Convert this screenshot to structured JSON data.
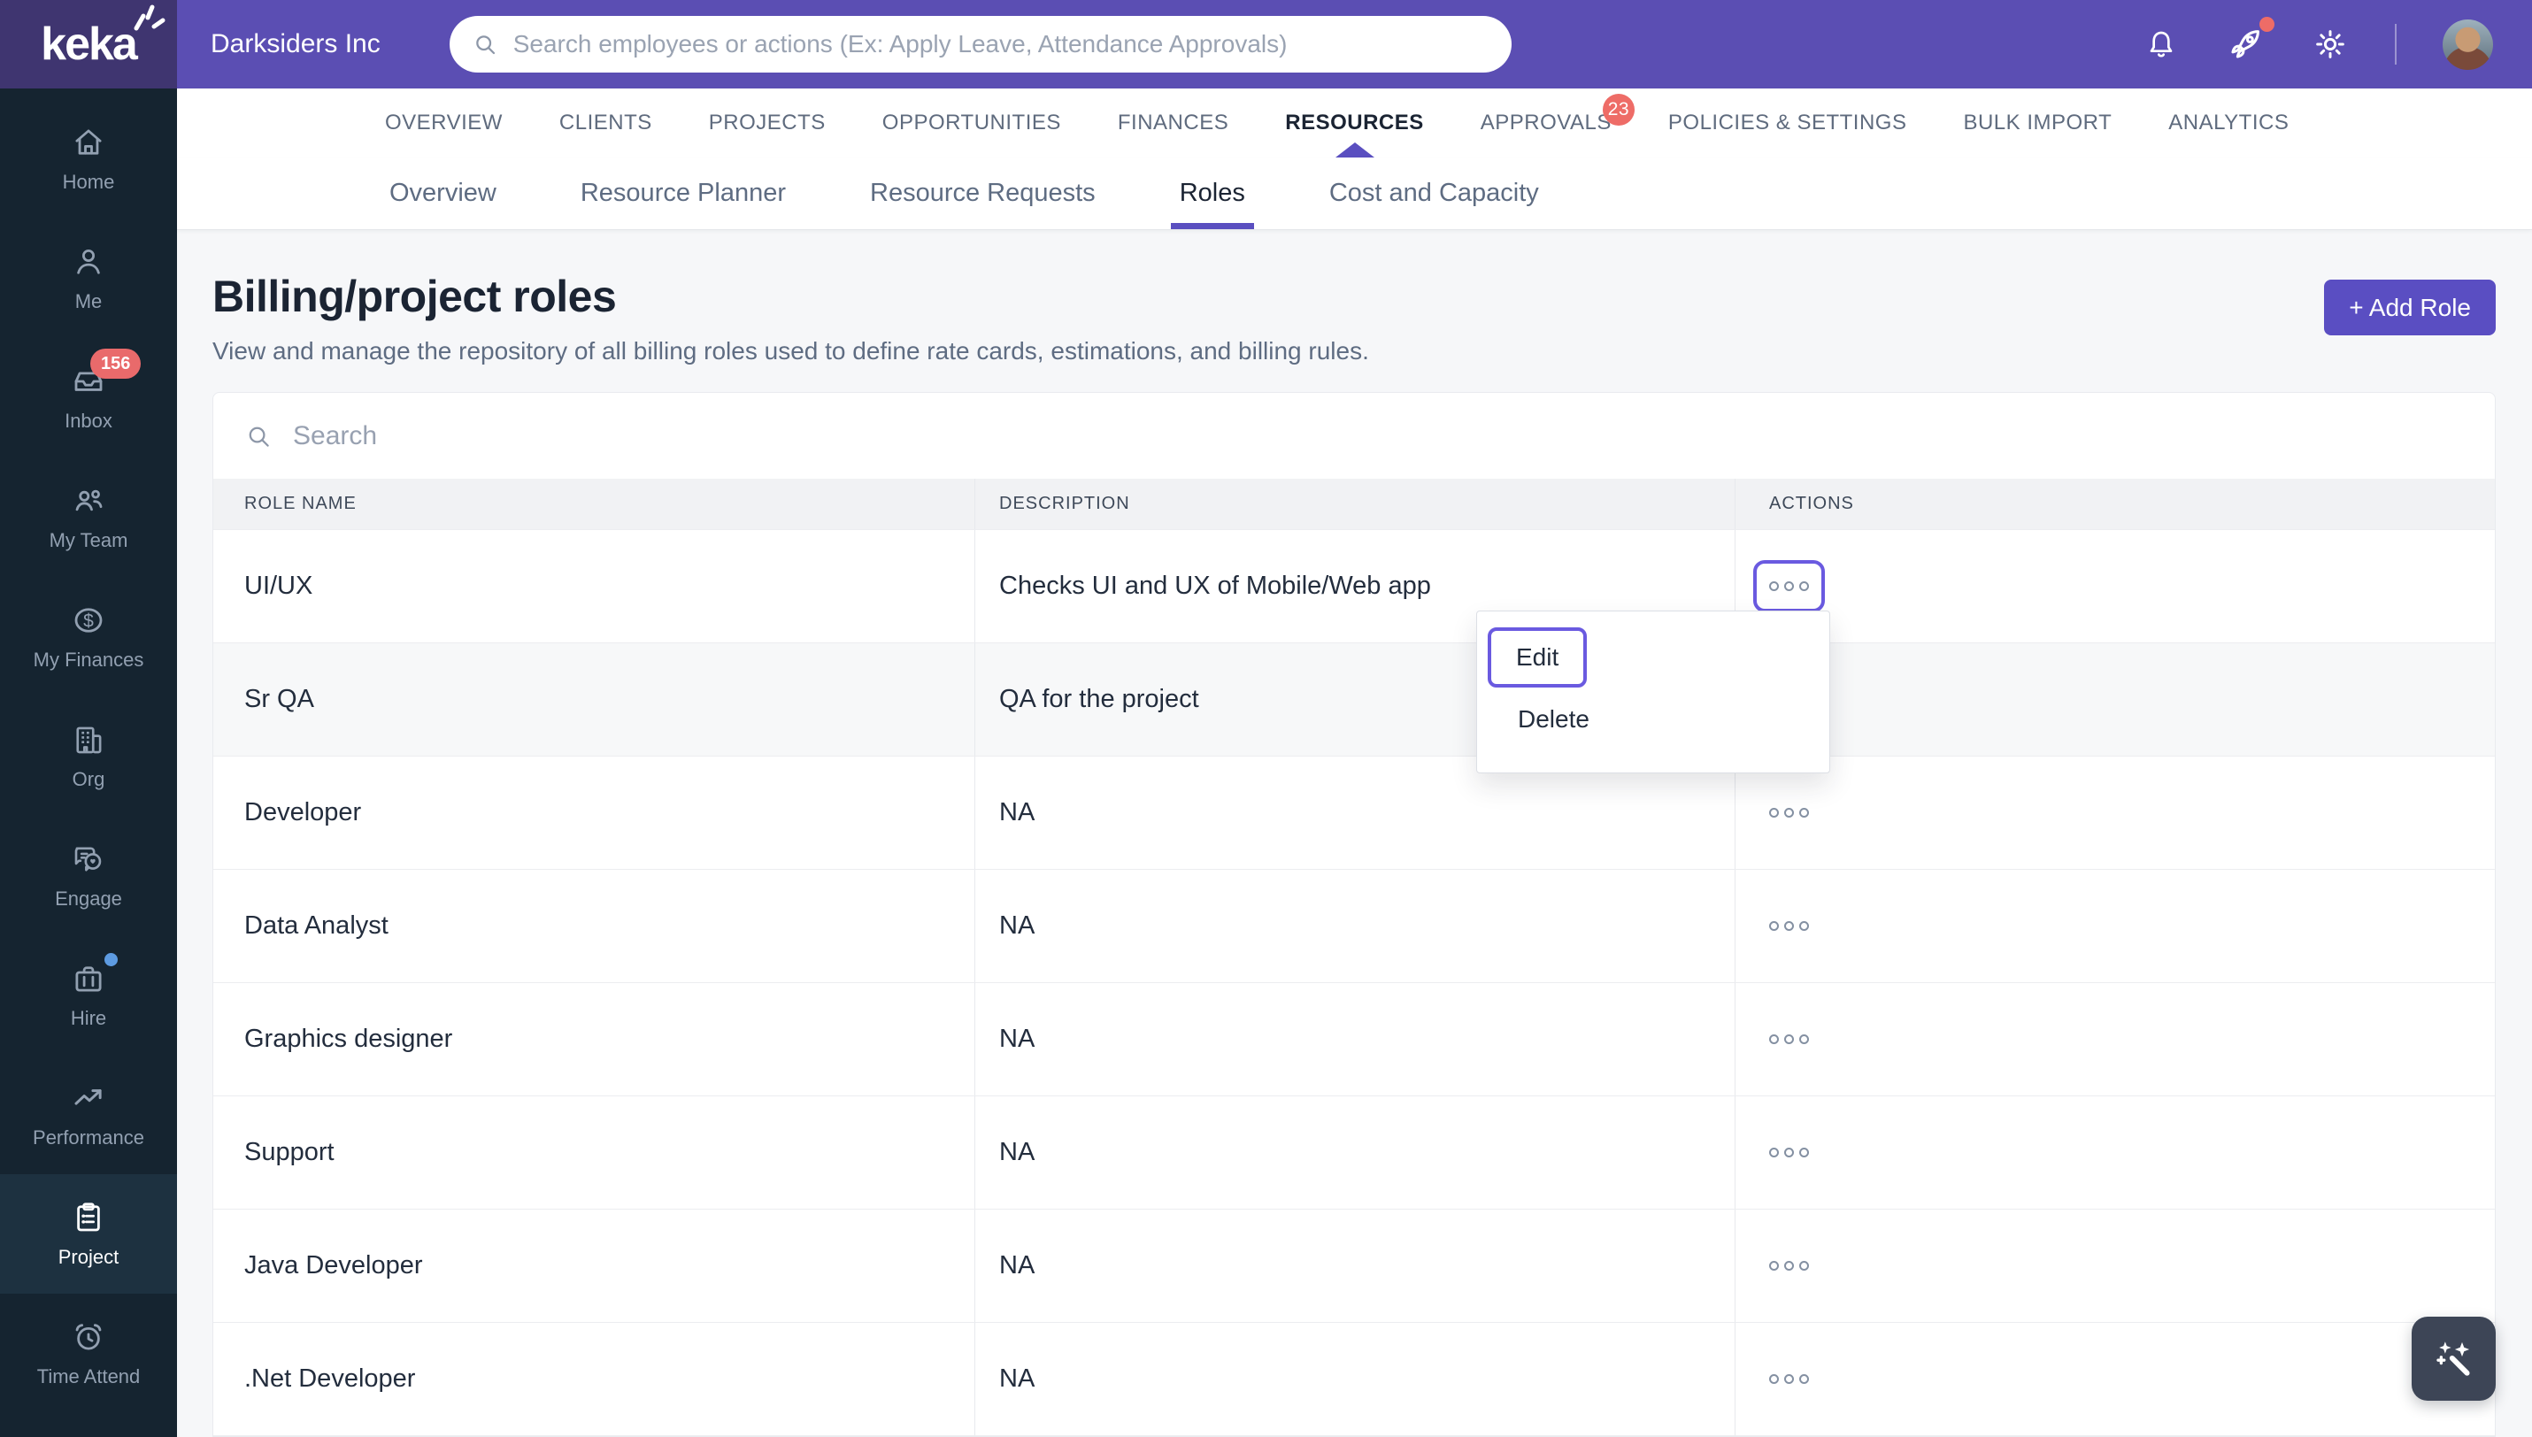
{
  "topbar": {
    "logo_text": "keka",
    "company_name": "Darksiders Inc",
    "search_placeholder": "Search employees or actions (Ex: Apply Leave, Attendance Approvals)",
    "icons": [
      "bell-icon",
      "rocket-icon",
      "gear-icon",
      "avatar"
    ]
  },
  "main_nav": {
    "items": [
      {
        "label": "OVERVIEW",
        "active": false
      },
      {
        "label": "CLIENTS",
        "active": false
      },
      {
        "label": "PROJECTS",
        "active": false
      },
      {
        "label": "OPPORTUNITIES",
        "active": false
      },
      {
        "label": "FINANCES",
        "active": false
      },
      {
        "label": "RESOURCES",
        "active": true
      },
      {
        "label": "APPROVALS",
        "active": false,
        "badge": "23"
      },
      {
        "label": "POLICIES & SETTINGS",
        "active": false
      },
      {
        "label": "BULK IMPORT",
        "active": false
      },
      {
        "label": "ANALYTICS",
        "active": false
      }
    ]
  },
  "sub_nav": {
    "items": [
      {
        "label": "Overview",
        "active": false
      },
      {
        "label": "Resource Planner",
        "active": false
      },
      {
        "label": "Resource Requests",
        "active": false
      },
      {
        "label": "Roles",
        "active": true
      },
      {
        "label": "Cost and Capacity",
        "active": false
      }
    ]
  },
  "sidebar": {
    "items": [
      {
        "label": "Home",
        "icon": "home-icon"
      },
      {
        "label": "Me",
        "icon": "user-icon"
      },
      {
        "label": "Inbox",
        "icon": "inbox-icon",
        "badge": "156"
      },
      {
        "label": "My Team",
        "icon": "team-icon"
      },
      {
        "label": "My Finances",
        "icon": "dollar-icon"
      },
      {
        "label": "Org",
        "icon": "building-icon"
      },
      {
        "label": "Engage",
        "icon": "chat-icon"
      },
      {
        "label": "Hire",
        "icon": "briefcase-icon",
        "notification_dot": true
      },
      {
        "label": "Performance",
        "icon": "trend-icon"
      },
      {
        "label": "Project",
        "icon": "clipboard-icon",
        "active": true
      },
      {
        "label": "Time Attend",
        "icon": "alarm-icon"
      }
    ]
  },
  "page": {
    "title": "Billing/project roles",
    "subtitle": "View and manage the repository of all billing roles used to define rate cards, estimations, and billing rules.",
    "add_role_label": "+ Add Role"
  },
  "table": {
    "search_placeholder": "Search",
    "columns": [
      "ROLE NAME",
      "DESCRIPTION",
      "ACTIONS"
    ],
    "rows": [
      {
        "role": "UI/UX",
        "description": "Checks UI and UX of Mobile/Web app"
      },
      {
        "role": "Sr QA",
        "description": "QA for the project"
      },
      {
        "role": "Developer",
        "description": "NA"
      },
      {
        "role": "Data Analyst",
        "description": "NA"
      },
      {
        "role": "Graphics designer",
        "description": "NA"
      },
      {
        "role": "Support",
        "description": "NA"
      },
      {
        "role": "Java Developer",
        "description": "NA"
      },
      {
        "role": ".Net Developer",
        "description": "NA"
      }
    ]
  },
  "context_menu": {
    "items": [
      {
        "label": "Edit",
        "focused": true
      },
      {
        "label": "Delete",
        "focused": false
      }
    ]
  },
  "colors": {
    "topbar_purple": "#5b4eb3",
    "logo_bg": "#3f3570",
    "accent_purple": "#5a4ec2",
    "focus_ring_purple": "#6a5ae0",
    "tab_indicator_purple": "#5a4fc0",
    "sidebar_bg": "#152430",
    "sidebar_active_bg": "#1d3140",
    "badge_red": "#ee6c67",
    "hire_dot_blue": "#5d9be1",
    "page_bg": "#f6f7f9",
    "table_header_bg": "#f1f2f4",
    "wand_button_bg": "#3d4556"
  }
}
